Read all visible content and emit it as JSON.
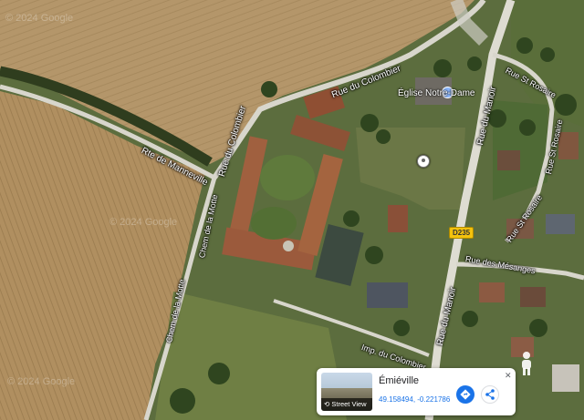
{
  "map": {
    "type": "satellite",
    "watermark": "© 2024 Google",
    "roads": {
      "rte_de_manneville": "Rte de Manneville",
      "rue_du_colombier_top": "Rue du Colombier",
      "rue_du_colombier_west": "Rue du Colombier",
      "chem_de_la_motte_1": "Chem de la Motte",
      "chem_de_la_motte_2": "Chem de la Motte",
      "rue_du_manoir_north": "Rue du Manoir",
      "rue_du_manoir_south": "Rue du Manoir",
      "rue_st_rosaire_1": "Rue St Rosaire",
      "rue_st_rosaire_2": "Rue St Rosaire",
      "rue_st_rosaire_3": "Rue St Rosaire",
      "rue_des_mesanges": "Rue des Mésanges",
      "imp_du_colombier": "Imp. du Colombier"
    },
    "poi": {
      "church_label": "Église Notre-Dame"
    },
    "route_badge": "D235"
  },
  "info_card": {
    "place_name": "Émiéville",
    "coordinates": "49.158494, -0.221786",
    "street_view_label": "Street View"
  },
  "colors": {
    "field_light": "#b99c6e",
    "field_dark": "#a88a5c",
    "vegetation": "#55683a",
    "road": "#cfcfc8",
    "directions_blue": "#1a73e8"
  }
}
